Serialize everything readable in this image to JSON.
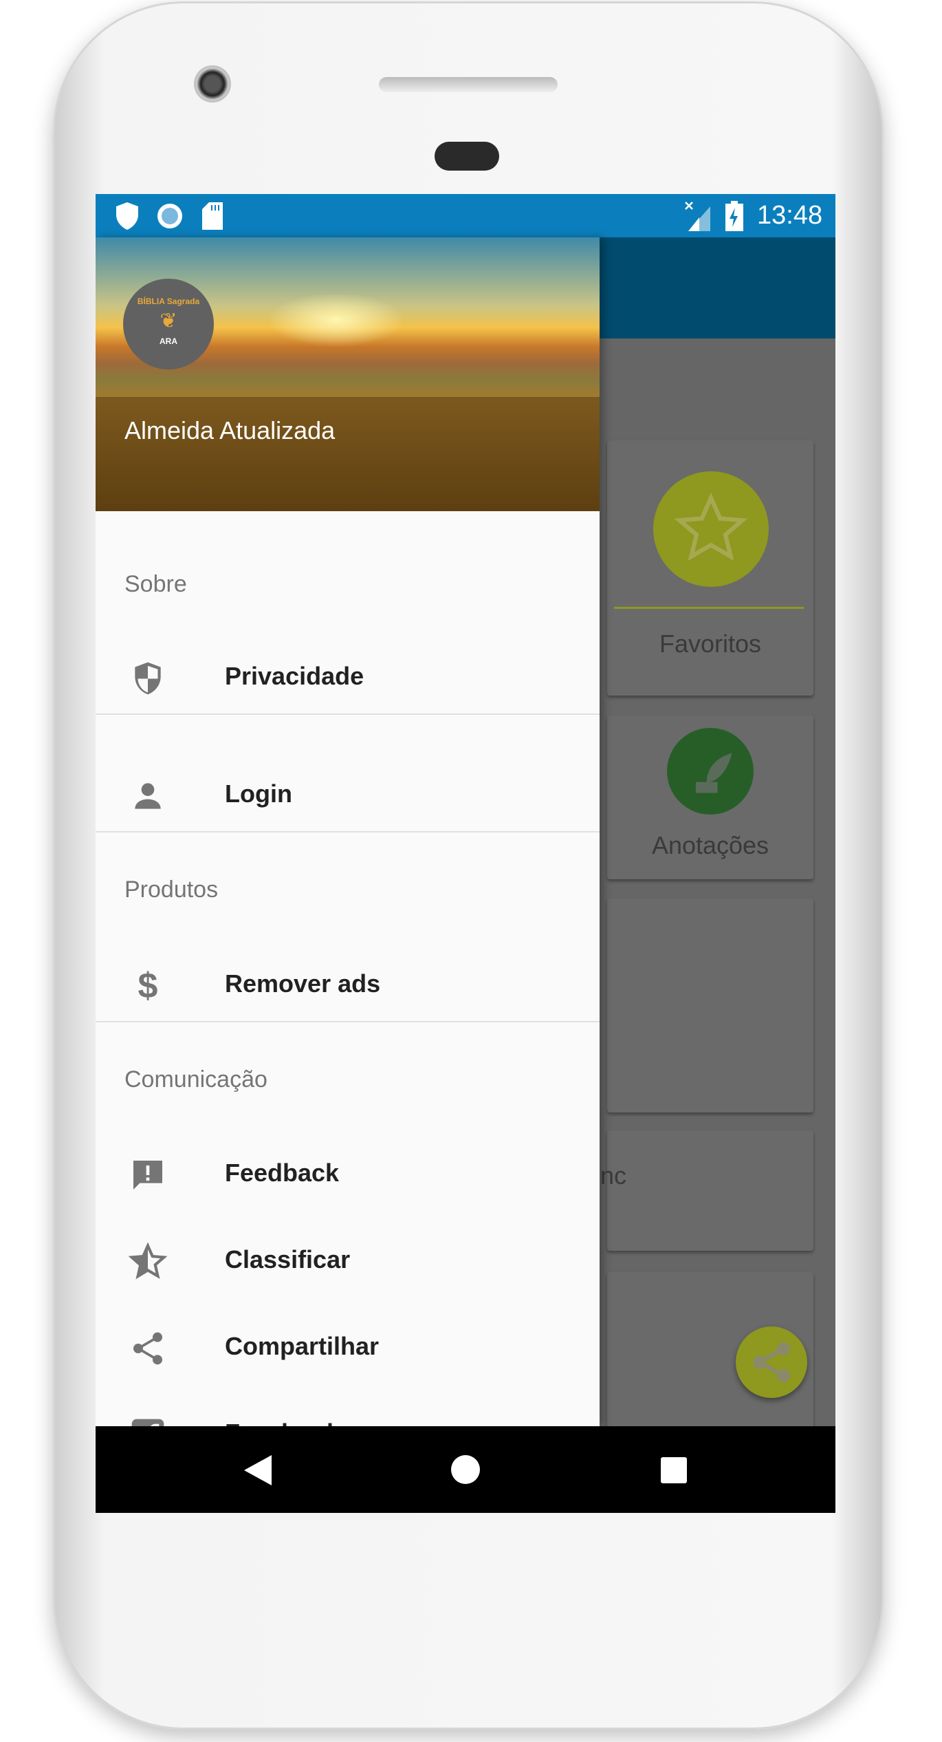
{
  "status_bar": {
    "time": "13:48",
    "icons": [
      "shield-icon",
      "circle-icon",
      "sd-card-icon",
      "no-signal-icon",
      "battery-charging-icon"
    ]
  },
  "drawer": {
    "header": {
      "title": "Almeida Atualizada",
      "logo": {
        "top": "BÍBLIA Sagrada",
        "bottom": "ARA"
      }
    },
    "sections": [
      {
        "label": "Sobre",
        "items": [
          {
            "label": "Privacidade",
            "icon": "shield-icon"
          }
        ]
      },
      {
        "label": "",
        "items": [
          {
            "label": "Login",
            "icon": "person-icon"
          }
        ]
      },
      {
        "label": "Produtos",
        "items": [
          {
            "label": "Remover ads",
            "icon": "dollar-icon"
          }
        ]
      },
      {
        "label": "Comunicação",
        "items": [
          {
            "label": "Feedback",
            "icon": "feedback-icon"
          },
          {
            "label": "Classificar",
            "icon": "star-half-icon"
          },
          {
            "label": "Compartilhar",
            "icon": "share-icon"
          },
          {
            "label": "Facebook",
            "icon": "facebook-icon"
          }
        ]
      }
    ]
  },
  "main": {
    "cards": [
      {
        "label": "Favoritos",
        "icon": "star-icon"
      },
      {
        "label": "Anotações",
        "icon": "quill-icon"
      },
      {
        "label": ""
      },
      {
        "label": "nc"
      },
      {
        "label": ""
      }
    ],
    "fab_icon": "share-icon",
    "colors": {
      "favoritos": "#c8d42e",
      "anotacoes": "#3a9a3a"
    }
  },
  "nav_bar": {
    "buttons": [
      "back",
      "home",
      "recents"
    ]
  }
}
